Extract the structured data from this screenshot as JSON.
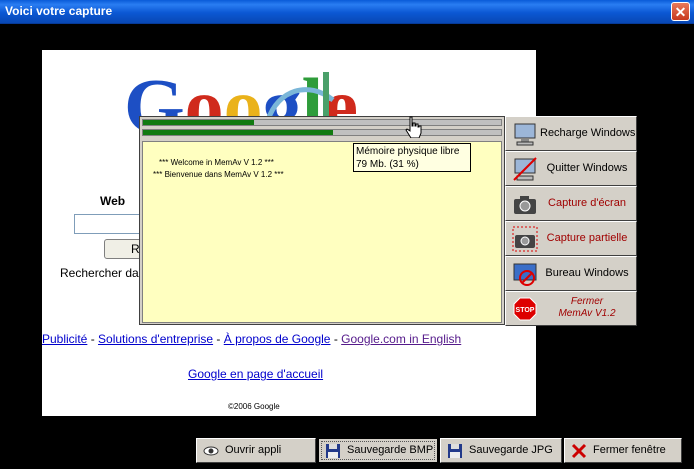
{
  "window": {
    "title": "Voici votre capture",
    "close_glyph": "✕"
  },
  "capture": {
    "logo_text": "Google",
    "web_label": "Web",
    "search_button_fragment": "R",
    "search_text": "Rechercher da",
    "links": [
      {
        "label": "Publicité",
        "visited": false
      },
      {
        "label": "Solutions d'entreprise",
        "visited": false
      },
      {
        "label": "À propos de Google",
        "visited": false
      },
      {
        "label": "Google.com in English",
        "visited": true
      }
    ],
    "separator": " - ",
    "home_link": "Google en page d'accueil",
    "copyright": "©2006 Google"
  },
  "memav": {
    "memory_bars": [
      0.31,
      0.53
    ],
    "log_lines": [
      "*** Welcome in MemAv V 1.2 ***",
      "*** Bienvenue dans MemAv V 1.2 ***"
    ],
    "tooltip": {
      "title": "Mémoire physique libre",
      "value": "79 Mb.   (31 %)"
    },
    "buttons": [
      {
        "label": "Recharge Windows",
        "icon": "computer-icon",
        "color": "black"
      },
      {
        "label": "Quitter Windows",
        "icon": "no-computer-icon",
        "color": "black"
      },
      {
        "label": "Capture d'écran",
        "icon": "camera-icon",
        "color": "red"
      },
      {
        "label": "Capture partielle",
        "icon": "camera-partial-icon",
        "color": "red"
      },
      {
        "label": "Bureau Windows",
        "icon": "no-desktop-icon",
        "color": "black"
      },
      {
        "label_line1": "Fermer",
        "label_line2": "MemAv V1.2",
        "icon": "stop-icon",
        "color": "red"
      }
    ]
  },
  "bottom_bar": {
    "buttons": [
      {
        "label": "Ouvrir appli",
        "icon": "eye-icon"
      },
      {
        "label": "Sauvegarde BMP",
        "icon": "floppy-icon"
      },
      {
        "label": "Sauvegarde JPG",
        "icon": "floppy-icon"
      },
      {
        "label": "Fermer fenêtre",
        "icon": "red-x-icon"
      }
    ]
  }
}
